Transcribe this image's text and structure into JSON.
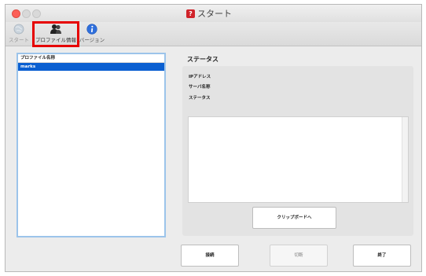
{
  "window": {
    "title": "スタート"
  },
  "toolbar": {
    "start_label": "スタート",
    "profile_label": "プロファイル情報",
    "version_label": "バージョン"
  },
  "profiles": {
    "header": "プロファイル名称",
    "items": [
      "marks"
    ]
  },
  "status": {
    "title": "ステータス",
    "ip_label": "IPアドレス",
    "server_label": "サーバ名称",
    "status_label": "ステータス",
    "clipboard_button": "クリップボードへ"
  },
  "buttons": {
    "connect": "接続",
    "disconnect": "切断",
    "exit": "終了"
  },
  "colors": {
    "highlight": "#e60000",
    "selection": "#0a5fd1",
    "close": "#fc5f57"
  }
}
